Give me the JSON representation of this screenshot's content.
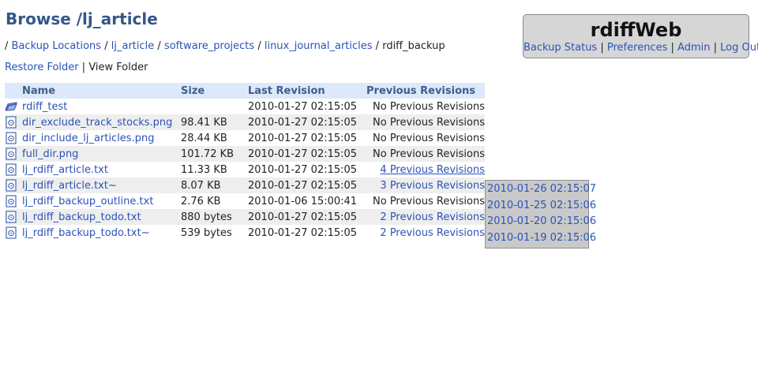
{
  "page": {
    "title": "Browse /lj_article"
  },
  "breadcrumb": {
    "root_sep": "/",
    "items": [
      {
        "label": "Backup Locations",
        "link": true
      },
      {
        "label": "lj_article",
        "link": true
      },
      {
        "label": "software_projects",
        "link": true
      },
      {
        "label": "linux_journal_articles",
        "link": true
      },
      {
        "label": "rdiff_backup",
        "link": false
      }
    ],
    "sep": "/"
  },
  "folder_actions": {
    "restore": "Restore Folder",
    "sep": "|",
    "view": "View Folder"
  },
  "app": {
    "name": "rdiffWeb",
    "links": [
      "Backup Status",
      "Preferences",
      "Admin",
      "Log Out"
    ],
    "sep": "|"
  },
  "table": {
    "headers": {
      "name": "Name",
      "size": "Size",
      "last": "Last Revision",
      "prev": "Previous Revisions"
    },
    "rows": [
      {
        "name": "rdiff_test",
        "size": "",
        "last": "2010-01-27 02:15:05",
        "prev": "No Previous Revisions",
        "icon": "folder-icon"
      },
      {
        "name": "dir_exclude_track_stocks.png",
        "size": "98.41 KB",
        "last": "2010-01-27 02:15:05",
        "prev": "No Previous Revisions",
        "icon": "file-icon"
      },
      {
        "name": "dir_include_lj_articles.png",
        "size": "28.44 KB",
        "last": "2010-01-27 02:15:05",
        "prev": "No Previous Revisions",
        "icon": "file-icon"
      },
      {
        "name": "full_dir.png",
        "size": "101.72 KB",
        "last": "2010-01-27 02:15:05",
        "prev": "No Previous Revisions",
        "icon": "file-icon"
      },
      {
        "name": "lj_rdiff_article.txt",
        "size": "11.33 KB",
        "last": "2010-01-27 02:15:05",
        "prev": "4 Previous Revisions",
        "icon": "file-icon"
      },
      {
        "name": "lj_rdiff_article.txt~",
        "size": "8.07 KB",
        "last": "2010-01-27 02:15:05",
        "prev": "3 Previous Revisions",
        "icon": "file-icon"
      },
      {
        "name": "lj_rdiff_backup_outline.txt",
        "size": "2.76 KB",
        "last": "2010-01-06 15:00:41",
        "prev": "No Previous Revisions",
        "icon": "file-icon"
      },
      {
        "name": "lj_rdiff_backup_todo.txt",
        "size": "880 bytes",
        "last": "2010-01-27 02:15:05",
        "prev": "2 Previous Revisions",
        "icon": "file-icon"
      },
      {
        "name": "lj_rdiff_backup_todo.txt~",
        "size": "539 bytes",
        "last": "2010-01-27 02:15:05",
        "prev": "2 Previous Revisions",
        "icon": "file-icon"
      }
    ]
  },
  "revisions_popup": {
    "dates": [
      "2010-01-26 02:15:07",
      "2010-01-25 02:15:06",
      "2010-01-20 02:15:06",
      "2010-01-19 02:15:06"
    ]
  }
}
